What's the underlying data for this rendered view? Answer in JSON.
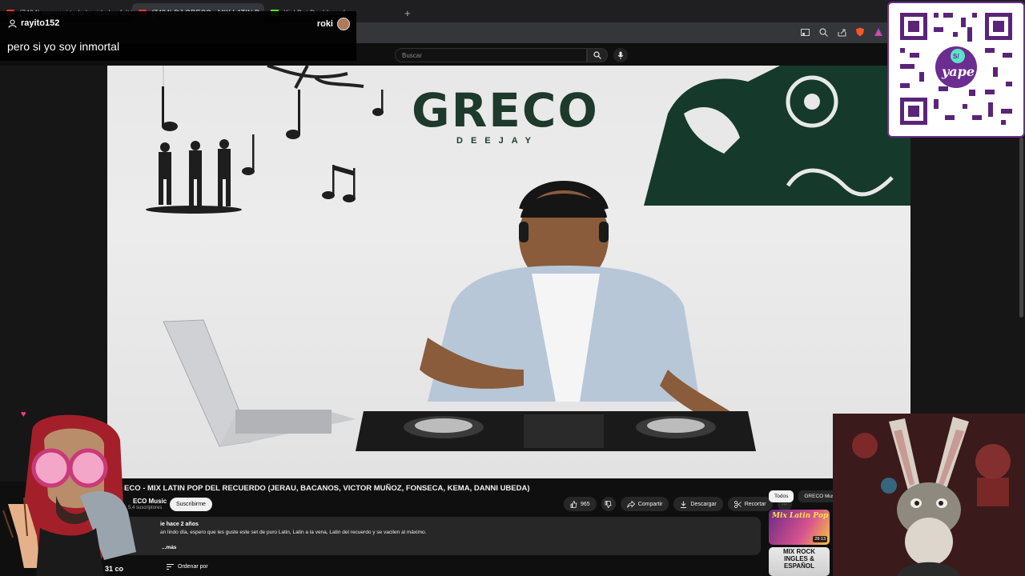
{
  "tabs": [
    {
      "label": "(7494) samurai todo lo vida les faltó",
      "active": false
    },
    {
      "label": "(7494) DJ GRECO - MIX LATIN P...",
      "active": true
    },
    {
      "label": "KickBot Dashboard",
      "active": false
    }
  ],
  "newtab_symbol": "+",
  "chat": {
    "username": "rayito152",
    "streamer": "roki",
    "message": "pero si yo soy inmortal"
  },
  "search": {
    "placeholder": "Buscar"
  },
  "video": {
    "brand": "GRECO",
    "brand_sub": "DEEJAY",
    "title": "ECO - MIX LATIN POP DEL RECUERDO (JERAU, BACANOS, VICTOR MUÑOZ, FONSECA, KEMA, DANNI UBEDA)",
    "channel": "ECO Music",
    "subscribers": "5,4 suscriptores",
    "subscribe_label": "Suscribirme"
  },
  "actions": {
    "likes": "965",
    "share": "Compartir",
    "download": "Descargar",
    "clip": "Recortar",
    "more": "···"
  },
  "description": {
    "meta": "ie   hace 2 años",
    "text": "an lindo día, espero que les guste este set de puro Latin, Latin a la vena, Latin del recuerdo y se vacilen al máximo.",
    "more": "...más"
  },
  "comments": {
    "count": "31 co",
    "sort_label": "Ordenar por"
  },
  "chips": [
    "Todos",
    "GRECO Music"
  ],
  "recommendations": [
    {
      "label": "Mix Latin Pop",
      "duration": "28:13"
    },
    {
      "label": "MIX ROCK INGLES & ESPAÑOL",
      "duration": ""
    }
  ],
  "qr": {
    "brand": "yape",
    "symbol": "S/",
    "color": "#6b2d8f"
  },
  "colors": {
    "accent": "#ff0000",
    "greco": "#1d3a2c",
    "yape": "#6b2d8f"
  }
}
